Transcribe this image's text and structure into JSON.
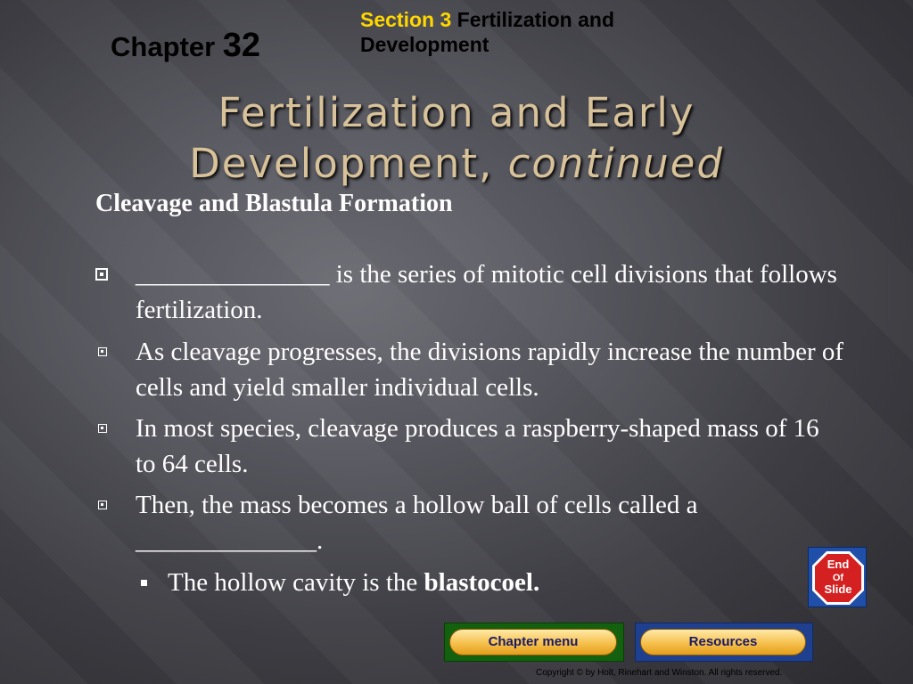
{
  "header": {
    "chapter_label": "Chapter",
    "chapter_number": "32",
    "section_label": "Section 3",
    "section_title": "Fertilization and Development"
  },
  "slide": {
    "title_main": "Fertilization and Early",
    "title_line2": "Development,",
    "title_continued": "continued",
    "subtitle": "Cleavage and Blastula Formation",
    "bullets": [
      {
        "blank": "_______________",
        "text": " is the series of mitotic cell divisions that follows fertilization."
      },
      {
        "text": "As cleavage progresses, the divisions rapidly increase the number of cells and yield smaller individual cells."
      },
      {
        "text": "In most species, cleavage produces a raspberry-shaped mass of 16 to 64 cells."
      },
      {
        "text": "Then, the mass becomes a hollow ball of cells called a",
        "blank": "______________",
        "end": "."
      }
    ],
    "sub_bullet": {
      "text": "The hollow cavity is the ",
      "bold": "blastocoel."
    }
  },
  "stop_sign": {
    "line1": "End",
    "line2": "Of",
    "line3": "Slide",
    "color": "#d42020"
  },
  "nav": {
    "chapter_menu_label": "Chapter menu",
    "resources_label": "Resources"
  },
  "footer": {
    "copyright": "Copyright © by Holt, Rinehart and Winston. All rights reserved."
  },
  "colors": {
    "section_accent": "#ffd700",
    "title": "#d8c29a",
    "body_text": "#ffffff"
  }
}
